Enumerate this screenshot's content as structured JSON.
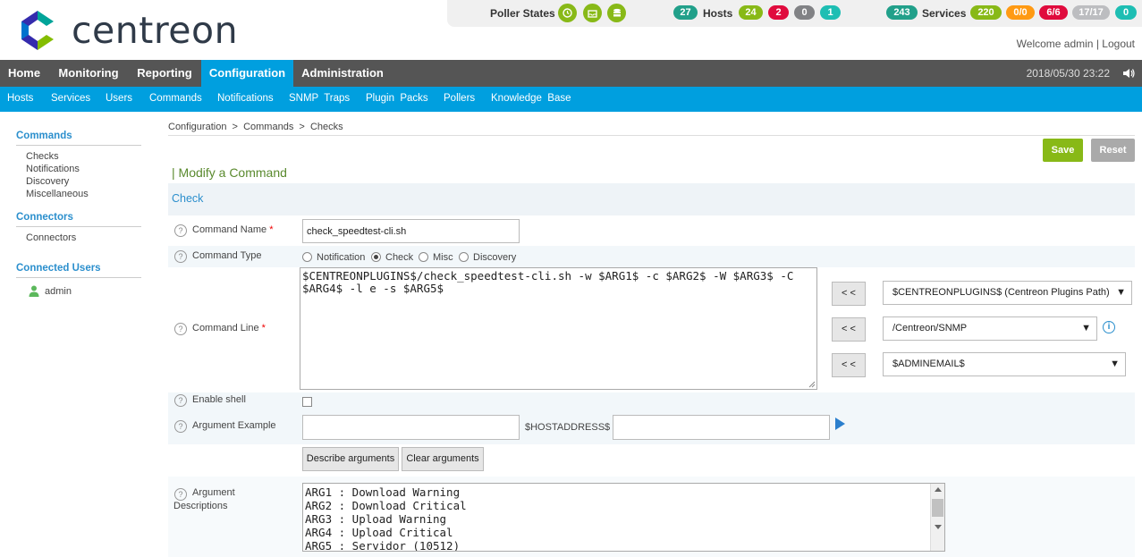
{
  "brand": {
    "name": "centreon"
  },
  "status": {
    "poller_label": "Poller States",
    "hosts_total": "27",
    "hosts_label": "Hosts",
    "hosts_up": "24",
    "hosts_down": "2",
    "hosts_unreach": "0",
    "hosts_pending": "1",
    "services_total": "243",
    "services_label": "Services",
    "svc_ok": "220",
    "svc_warn": "0/0",
    "svc_crit": "6/6",
    "svc_unknown": "17/17",
    "svc_pending": "0",
    "colors": {
      "teal": "#21a08a",
      "green": "#88b917",
      "red": "#e00b3d",
      "gray": "#818285",
      "orange": "#ff9a13",
      "light": "#bcbdc0",
      "cyan": "#1ebeb3"
    }
  },
  "welcome": {
    "text": "Welcome admin",
    "sep": "|",
    "logout": "Logout"
  },
  "nav": {
    "items": [
      "Home",
      "Monitoring",
      "Reporting",
      "Configuration",
      "Administration"
    ],
    "active": "Configuration",
    "datetime": "2018/05/30 23:22"
  },
  "subnav": [
    "Hosts",
    "Services",
    "Users",
    "Commands",
    "Notifications",
    "SNMP  Traps",
    "Plugin  Packs",
    "Pollers",
    "Knowledge  Base"
  ],
  "sidebar": {
    "commands_title": "Commands",
    "commands_items": [
      "Checks",
      "Notifications",
      "Discovery",
      "Miscellaneous"
    ],
    "connectors_title": "Connectors",
    "connectors_items": [
      "Connectors"
    ],
    "users_title": "Connected Users",
    "users": [
      "admin"
    ]
  },
  "breadcrumb": "Configuration  >  Commands  >  Checks",
  "toolbar": {
    "save": "Save",
    "reset": "Reset"
  },
  "form": {
    "title": "| Modify a Command",
    "section": "Check",
    "qm": "?",
    "required_mark": "*",
    "command_name_label": "Command Name",
    "command_name_value": "check_speedtest-cli.sh",
    "command_type_label": "Command Type",
    "command_types": [
      "Notification",
      "Check",
      "Misc",
      "Discovery"
    ],
    "command_type_selected": "Check",
    "command_line_label": "Command Line",
    "command_line_value": "$CENTREONPLUGINS$/check_speedtest-cli.sh -w $ARG1$ -c $ARG2$ -W $ARG3$ -C $ARG4$ -l e -s $ARG5$",
    "insert_button": "< <",
    "macro_select_1": "$CENTREONPLUGINS$ (Centreon Plugins Path)",
    "macro_select_2": "/Centreon/SNMP",
    "macro_select_3": "$ADMINEMAIL$",
    "dropdown_arrow": "▼",
    "info_icon": "i",
    "enable_shell_label": "Enable shell",
    "argument_example_label": "Argument Example",
    "host_address_label": "$HOSTADDRESS$",
    "describe_button": "Describe arguments",
    "clear_button": "Clear arguments",
    "arg_desc_label_1": "Argument",
    "arg_desc_label_2": "Descriptions",
    "arg_descriptions": "ARG1 : Download Warning\nARG2 : Download Critical\nARG3 : Upload Warning\nARG4 : Upload Critical\nARG5 : Servidor (10512)"
  }
}
